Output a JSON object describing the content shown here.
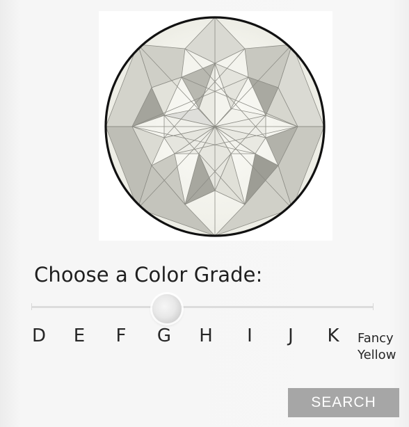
{
  "selector": {
    "heading": "Choose a Color Grade:",
    "grades": [
      "D",
      "E",
      "F",
      "G",
      "H",
      "I",
      "J",
      "K"
    ],
    "fancy_line1": "Fancy",
    "fancy_line2": "Yellow",
    "selected_grade": "G"
  },
  "actions": {
    "search_label": "SEARCH"
  },
  "colors": {
    "button_bg": "#a6a6a6",
    "button_text": "#ffffff",
    "diamond_outline": "#111111"
  }
}
